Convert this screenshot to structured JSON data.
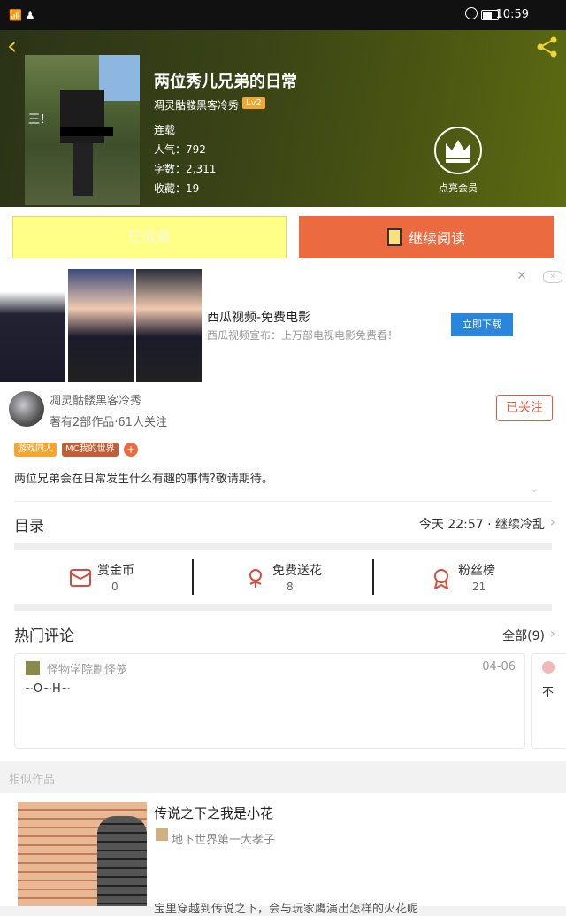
{
  "status_bar": {
    "time": "10:59"
  },
  "header": {
    "title": "两位秀儿兄弟的日常",
    "author": "凋灵骷髅黑客冷秀",
    "level": "Lv2",
    "status": "连载",
    "stats": [
      {
        "label": "人气：",
        "value": "792"
      },
      {
        "label": "字数：",
        "value": "2,311"
      },
      {
        "label": "收藏：",
        "value": "19"
      }
    ],
    "cover_caption": "王！",
    "vip_label": "点亮会员"
  },
  "actions": {
    "collected_label": "已收藏",
    "read_label": "继续阅读"
  },
  "ad": {
    "title": "西瓜视频-免费电影",
    "desc": "西瓜视频宣布：上万部电视电影免费看！",
    "button": "立即下载",
    "close": "✕",
    "badge": "✕"
  },
  "author_section": {
    "name": "凋灵骷髅黑客冷秀",
    "meta": "著有2部作品·61人关注",
    "follow": "已关注",
    "tags": [
      "游戏同人",
      "MC我的世界"
    ],
    "tag_add": "+",
    "description": "两位兄弟会在日常发生什么有趣的事情?敬请期待。",
    "expand": "⌄",
    "catalog_label": "目录",
    "catalog_latest": "今天 22:57 · 继续冷乱",
    "arrow": "›"
  },
  "gifts": [
    {
      "label": "赏金币",
      "value": "0",
      "icon": "coin-envelope-icon"
    },
    {
      "label": "免费送花",
      "value": "8",
      "icon": "flower-icon"
    },
    {
      "label": "粉丝榜",
      "value": "21",
      "icon": "medal-icon"
    }
  ],
  "comments": {
    "label": "热门评论",
    "all": "全部(9)",
    "items": [
      {
        "user": "怪物学院刷怪笼",
        "date": "04-06",
        "text": "~O~H~"
      },
      {
        "text": "不"
      }
    ]
  },
  "similar": {
    "label": "相似作品",
    "title": "传说之下之我是小花",
    "author": "地下世界第一大孝子",
    "desc": "宝里穿越到传说之下，会与玩家鹰演出怎样的火花呢"
  }
}
